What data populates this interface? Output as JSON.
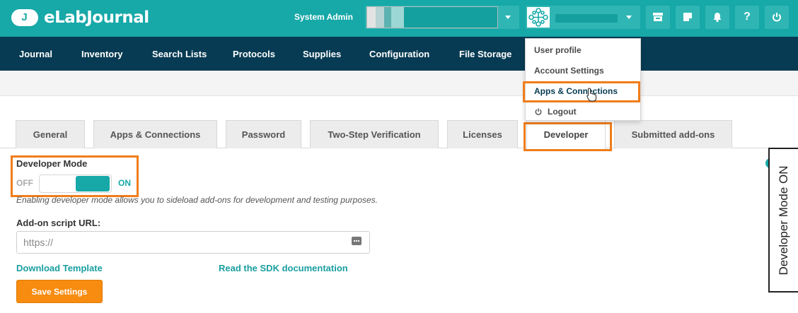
{
  "app": {
    "title": "eLabJournal",
    "logo_mark": "J"
  },
  "header": {
    "user_label": "System Admin"
  },
  "nav": {
    "items": [
      "Journal",
      "Inventory",
      "Search Lists",
      "Protocols",
      "Supplies",
      "Configuration",
      "File Storage"
    ]
  },
  "user_menu": {
    "items": [
      "User profile",
      "Account Settings",
      "Apps & Connections",
      "Logout"
    ]
  },
  "tabs": [
    "General",
    "Apps & Connections",
    "Password",
    "Two-Step Verification",
    "Licenses",
    "Developer",
    "Submitted add-ons"
  ],
  "developer": {
    "mode_label": "Developer Mode",
    "off_label": "OFF",
    "on_label": "ON",
    "mode_on": true,
    "description": "Enabling developer mode allows you to sideload add-ons for development and testing purposes.",
    "url_label": "Add-on script URL:",
    "url_placeholder": "https://",
    "download_link": "Download Template",
    "sdk_link": "Read the SDK documentation",
    "save_label": "Save Settings"
  },
  "annotation": {
    "text": "Developer Mode ON"
  },
  "colors": {
    "accent": "#17a8a8",
    "nav": "#073b53",
    "highlight": "#f07d1a",
    "save": "#f78c10"
  }
}
